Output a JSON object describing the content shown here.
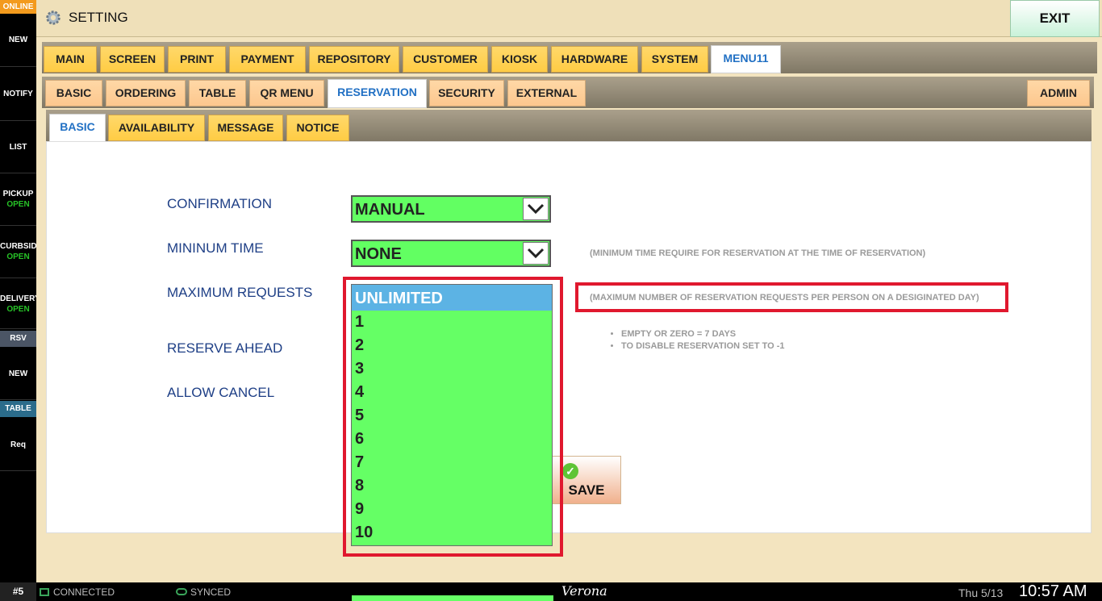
{
  "sidebar": {
    "online": "ONLINE",
    "items": [
      {
        "label": "NEW"
      },
      {
        "label": "NOTIFY"
      },
      {
        "label": "LIST"
      },
      {
        "label": "PICKUP",
        "sub": "OPEN"
      },
      {
        "label": "CURBSIDE",
        "sub": "OPEN"
      },
      {
        "label": "DELIVERY",
        "sub": "OPEN"
      },
      {
        "label": "RSV"
      },
      {
        "label": "NEW"
      },
      {
        "label": "TABLE"
      },
      {
        "label": "Req"
      }
    ]
  },
  "header": {
    "title": "SETTING",
    "exit_label": "EXIT"
  },
  "tabs_main": [
    "MAIN",
    "SCREEN",
    "PRINT",
    "PAYMENT",
    "REPOSITORY",
    "CUSTOMER",
    "KIOSK",
    "HARDWARE",
    "SYSTEM",
    "MENU11"
  ],
  "tabs_sub": [
    "BASIC",
    "ORDERING",
    "TABLE",
    "QR MENU",
    "RESERVATION",
    "SECURITY",
    "EXTERNAL",
    "ADMIN"
  ],
  "tabs_inner": [
    "BASIC",
    "AVAILABILITY",
    "MESSAGE",
    "NOTICE"
  ],
  "form": {
    "confirmation": {
      "label": "CONFIRMATION",
      "value": "MANUAL"
    },
    "minimum_time": {
      "label": "MININUM TIME",
      "value": "NONE",
      "note": "(MINIMUM TIME REQUIRE FOR RESERVATION AT THE TIME OF RESERVATION)"
    },
    "maximum_requests": {
      "label": "MAXIMUM REQUESTS",
      "note": "(MAXIMUM NUMBER OF RESERVATION REQUESTS PER PERSON ON A DESIGINATED DAY)"
    },
    "reserve_ahead": {
      "label": "RESERVE AHEAD",
      "bullets": [
        "EMPTY OR ZERO = 7 DAYS",
        "TO DISABLE RESERVATION SET TO -1"
      ]
    },
    "allow_cancel": {
      "label": "ALLOW CANCEL"
    }
  },
  "dropdown": {
    "options": [
      "UNLIMITED",
      "1",
      "2",
      "3",
      "4",
      "5",
      "6",
      "7",
      "8",
      "9",
      "10"
    ],
    "selected": "UNLIMITED"
  },
  "save_label": "SAVE",
  "status_bar": {
    "station": "#5",
    "connection": "CONNECTED",
    "sync": "SYNCED",
    "brand": "Verona",
    "date": "Thu 5/13",
    "time": "10:57 AM"
  },
  "colors": {
    "accent_orange": "#f39a1d",
    "tab_yellow": "#ffcc44",
    "tab_peach": "#fcc78e",
    "combo_green": "#62ff62",
    "highlight_red": "#e0182e",
    "selected_blue": "#5cb3e4",
    "label_blue": "#1e3f86"
  }
}
